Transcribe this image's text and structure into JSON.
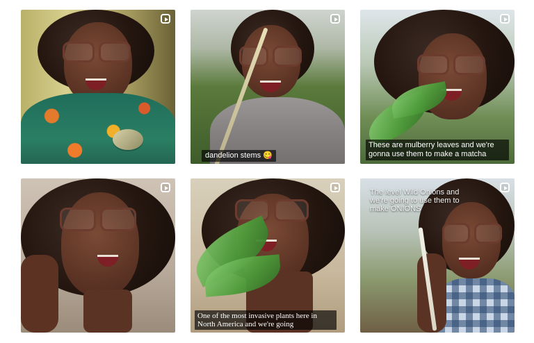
{
  "tiles": [
    {
      "icon": "reel-icon",
      "caption": ""
    },
    {
      "icon": "reel-icon",
      "caption": "dandelion stems 😋"
    },
    {
      "icon": "reel-icon",
      "caption": "These are mulberry leaves and we're gonna use them to make a matcha"
    },
    {
      "icon": "reel-icon",
      "caption": ""
    },
    {
      "icon": "reel-icon",
      "caption": "One of the most invasive plants here in North America and we're going"
    },
    {
      "icon": "reel-icon",
      "caption": "The level Wild Onions and we're going to use them to make ONIONS"
    }
  ]
}
